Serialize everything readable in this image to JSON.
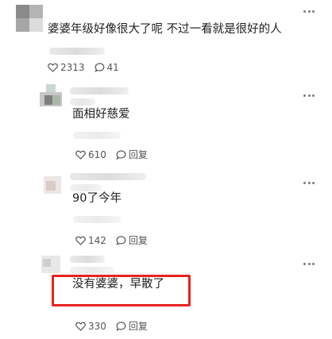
{
  "comments": [
    {
      "text": "婆婆年级好像很大了呢 不过一看就是很好的人",
      "likes": "2313",
      "replies": "41"
    },
    {
      "text": "面相好慈爱",
      "likes": "610",
      "reply_label": "回复"
    },
    {
      "text": "90了今年",
      "likes": "142",
      "reply_label": "回复"
    },
    {
      "text": "没有婆婆，早散了",
      "likes": "330",
      "reply_label": "回复"
    }
  ],
  "colors": {
    "highlight": "#e8231f",
    "text": "#202020",
    "meta": "#555555"
  },
  "icons": [
    "heart-icon",
    "comment-bubble-icon",
    "more-dots-icon"
  ]
}
